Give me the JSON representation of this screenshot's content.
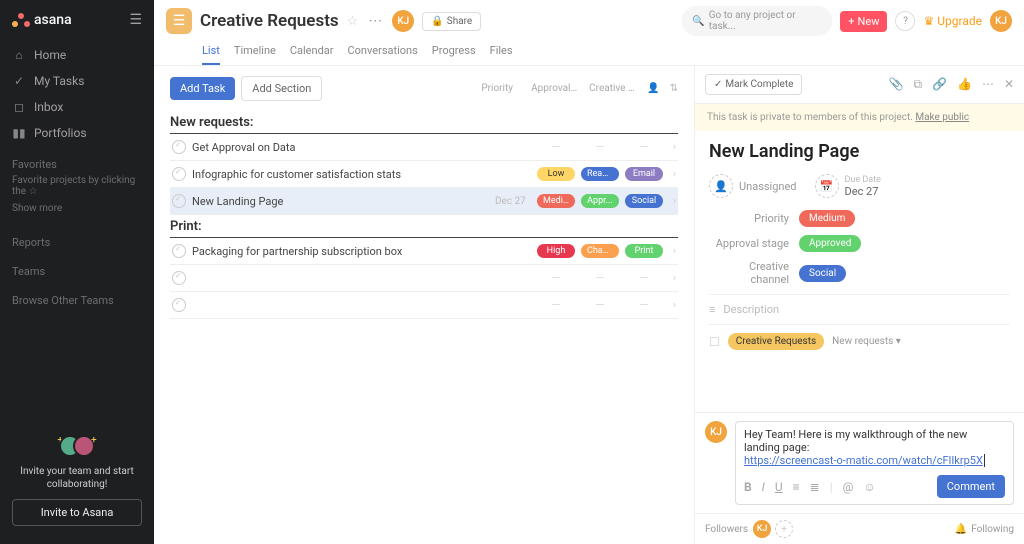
{
  "app": {
    "name": "asana"
  },
  "sidebar": {
    "nav": [
      {
        "label": "Home",
        "icon": "home"
      },
      {
        "label": "My Tasks",
        "icon": "check"
      },
      {
        "label": "Inbox",
        "icon": "inbox"
      },
      {
        "label": "Portfolios",
        "icon": "bars"
      }
    ],
    "sections": {
      "favorites": "Favorites",
      "fav_hint": "Favorite projects by clicking the",
      "show_more": "Show more",
      "reports": "Reports",
      "teams": "Teams",
      "browse": "Browse Other Teams"
    },
    "invite_text": "Invite your team and start collaborating!",
    "invite_btn": "Invite to Asana"
  },
  "header": {
    "project_title": "Creative Requests",
    "share": "Share",
    "search_placeholder": "Go to any project or task...",
    "new_btn": "New",
    "upgrade": "Upgrade",
    "user_initials": "KJ"
  },
  "tabs": [
    "List",
    "Timeline",
    "Calendar",
    "Conversations",
    "Progress",
    "Files"
  ],
  "toolbar": {
    "add_task": "Add Task",
    "add_section": "Add Section",
    "columns": [
      "Priority",
      "Approval st...",
      "Creative ch..."
    ]
  },
  "sections": [
    {
      "title": "New requests:",
      "tasks": [
        {
          "name": "Get Approval on Data"
        },
        {
          "name": "Infographic for customer satisfaction stats",
          "priority": {
            "text": "Low",
            "cls": "pill-low"
          },
          "stage": {
            "text": "Read...",
            "cls": "pill-ready"
          },
          "channel": {
            "text": "Email",
            "cls": "pill-email"
          }
        },
        {
          "name": "New Landing Page",
          "selected": true,
          "due": "Dec 27",
          "priority": {
            "text": "Medi...",
            "cls": "pill-med"
          },
          "stage": {
            "text": "Appr...",
            "cls": "pill-appr"
          },
          "channel": {
            "text": "Social",
            "cls": "pill-social"
          }
        }
      ]
    },
    {
      "title": "Print:",
      "tasks": [
        {
          "name": "Packaging for partnership subscription box",
          "priority": {
            "text": "High",
            "cls": "pill-high"
          },
          "stage": {
            "text": "Chan...",
            "cls": "pill-chan"
          },
          "channel": {
            "text": "Print",
            "cls": "pill-print"
          }
        },
        {
          "name": ""
        },
        {
          "name": ""
        }
      ]
    }
  ],
  "detail": {
    "complete": "Mark Complete",
    "privacy_text": "This task is private to members of this project.",
    "privacy_link": "Make public",
    "title": "New Landing Page",
    "unassigned": "Unassigned",
    "due_label": "Due Date",
    "due_value": "Dec 27",
    "fields": {
      "priority_label": "Priority",
      "priority_value": "Medium",
      "stage_label": "Approval stage",
      "stage_value": "Approved",
      "channel_label": "Creative channel",
      "channel_value": "Social"
    },
    "description_label": "Description",
    "project_tag": "Creative Requests",
    "section_tag": "New requests",
    "comment": {
      "text": "Hey Team! Here is my walkthrough of the new landing page:",
      "link": "https://screencast-o-matic.com/watch/cFlIkrp5X",
      "button": "Comment"
    },
    "followers_label": "Followers",
    "following_label": "Following"
  }
}
